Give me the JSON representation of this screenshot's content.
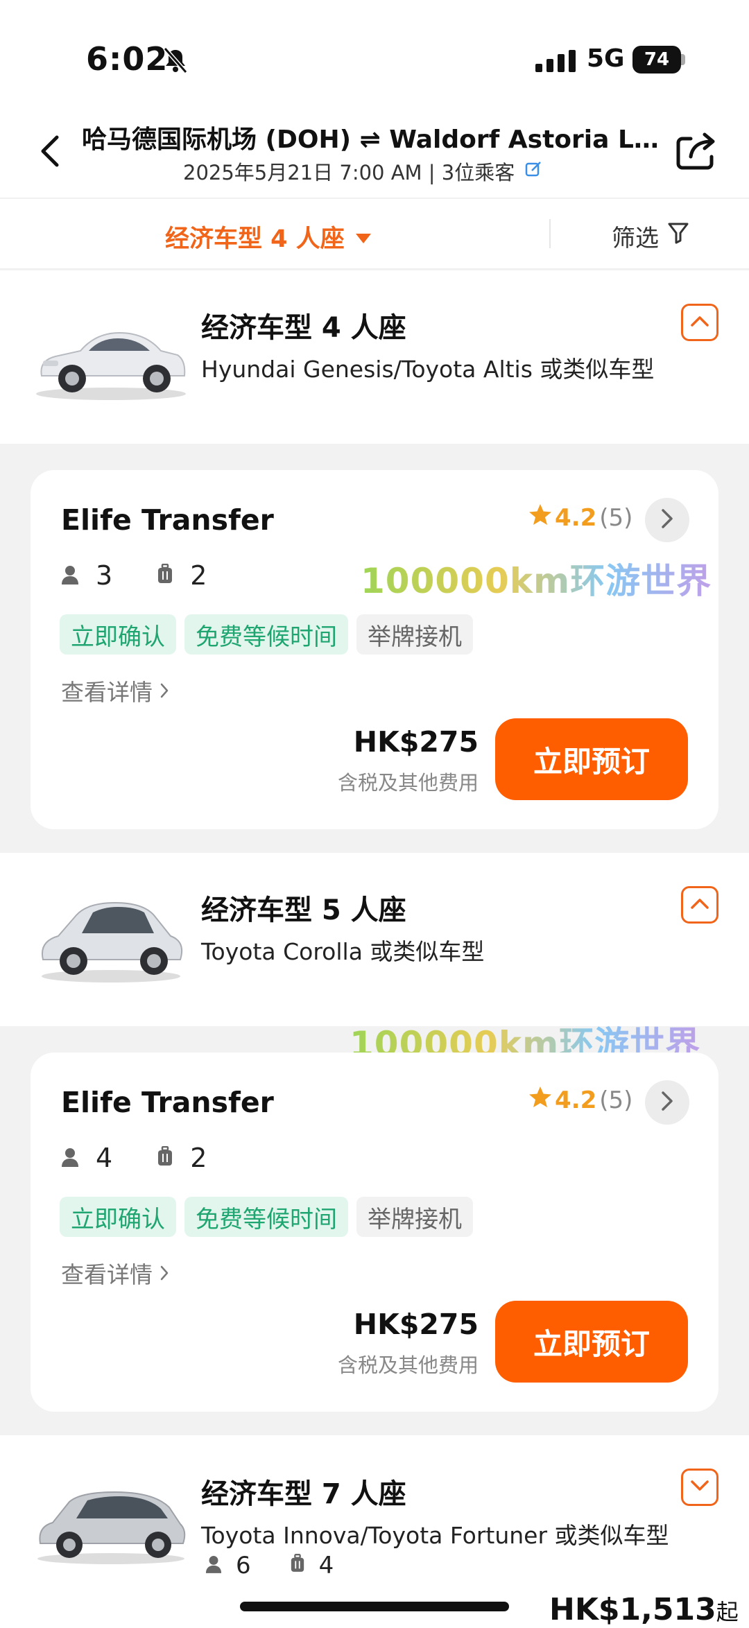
{
  "status": {
    "time": "6:02",
    "network": "5G",
    "battery": "74"
  },
  "header": {
    "route": "哈马德国际机场 (DOH) ⇌ Waldorf Astoria Lus...",
    "subtitle": "2025年5月21日 7:00 AM | 3位乘客"
  },
  "filter": {
    "selected": "经济车型 4 人座",
    "filter_label": "筛选"
  },
  "categories": [
    {
      "title": "经济车型 4 人座",
      "models": "Hyundai Genesis/Toyota Altis 或类似车型"
    },
    {
      "title": "经济车型 5 人座",
      "models": "Toyota Corolla 或类似车型"
    },
    {
      "title": "经济车型 7 人座",
      "models": "Toyota Innova/Toyota Fortuner 或类似车型",
      "passengers": "6",
      "luggage": "4",
      "price": "HK$1,513",
      "price_suffix": "起"
    }
  ],
  "cards": [
    {
      "supplier": "Elife Transfer",
      "rating": "4.2",
      "reviews": "(5)",
      "passengers": "3",
      "luggage": "2",
      "tags": [
        "立即确认",
        "免费等候时间",
        "举牌接机"
      ],
      "details": "查看详情",
      "price": "HK$275",
      "price_note": "含税及其他费用",
      "book": "立即预订"
    },
    {
      "supplier": "Elife Transfer",
      "rating": "4.2",
      "reviews": "(5)",
      "passengers": "4",
      "luggage": "2",
      "tags": [
        "立即确认",
        "免费等候时间",
        "举牌接机"
      ],
      "details": "查看详情",
      "price": "HK$275",
      "price_note": "含税及其他费用",
      "book": "立即预订"
    }
  ],
  "watermark": "100000km环游世界",
  "colors": {
    "accent": "#ff5e00",
    "orange_text": "#f0651a",
    "tag_green": "#1ea570",
    "star": "#f29d1e"
  }
}
